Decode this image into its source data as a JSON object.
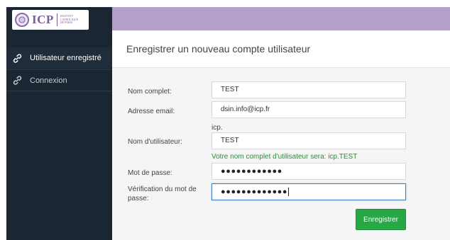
{
  "logo": {
    "text": "ICP",
    "subtitle_lines": [
      "Institut",
      "Catholique",
      "de Paris"
    ]
  },
  "sidebar": {
    "items": [
      {
        "label": "Utilisateur enregistré",
        "icon": "link-icon",
        "active": true
      },
      {
        "label": "Connexion",
        "icon": "link-icon",
        "active": false
      }
    ]
  },
  "page": {
    "title": "Enregistrer un nouveau compte utilisateur"
  },
  "form": {
    "full_name_label": "Nom complet:",
    "full_name_value": "TEST",
    "email_label": "Adresse email:",
    "email_value": "dsin.info@icp.fr",
    "username_prefix": "icp.",
    "username_label": "Nom d'utilisateur:",
    "username_value": "TEST",
    "username_hint": "Votre nom complet d'utilisateur sera: icp.TEST",
    "password_label": "Mot de passe:",
    "password_mask": "●●●●●●●●●●●●",
    "confirm_label": "Vérification du mot de passe:",
    "confirm_mask": "●●●●●●●●●●●●●",
    "submit_label": "Enregistrer"
  },
  "colors": {
    "sidebar_bg": "#1a2632",
    "header_bar": "#b49fca",
    "brand_purple": "#7b5c9c",
    "submit_green": "#27a845",
    "hint_green": "#2e8b3b",
    "focus_blue": "#3e7cc4"
  }
}
